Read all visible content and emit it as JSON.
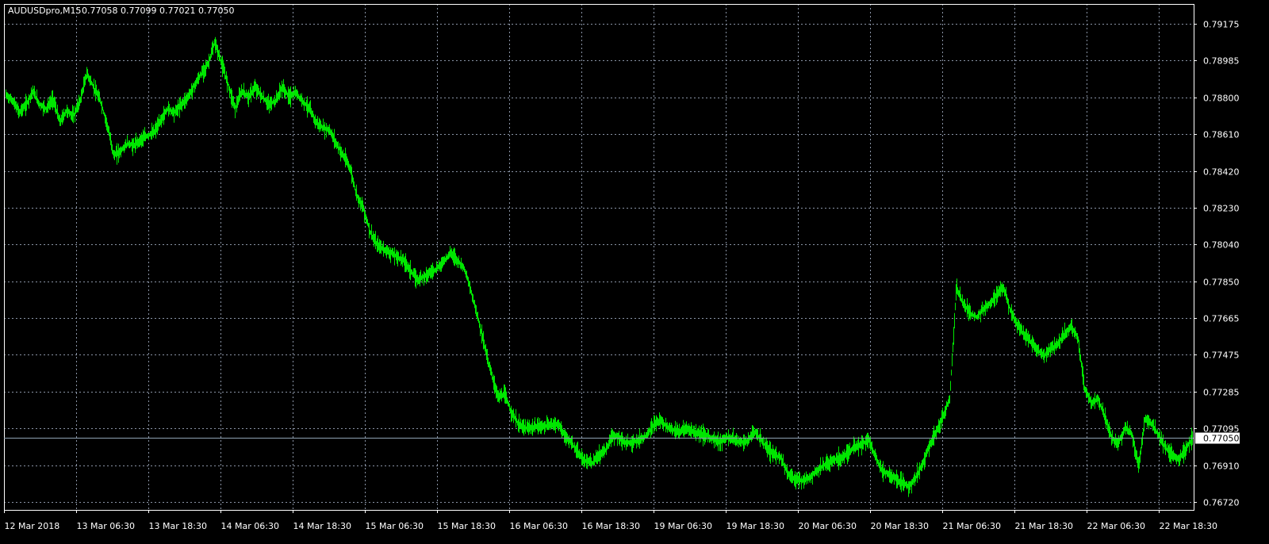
{
  "window": {
    "symbol_timeframe": "AUDUSDpro,M15",
    "ohlc_readout": "0.77058 0.77099 0.77021 0.77050"
  },
  "colors": {
    "background": "#000000",
    "candles": "#00e600",
    "grid": "#8a94a6",
    "axis": "#ffffff",
    "current_price_line": "#8fa2b3",
    "current_price_tag_bg": "#ffffff",
    "current_price_tag_text": "#000000"
  },
  "chart_data": {
    "type": "line",
    "symbol": "AUDUSDpro",
    "timeframe": "M15",
    "current_price": 0.7705,
    "current_price_label": "0.77050",
    "y_axis": {
      "min": 0.7672,
      "max": 0.79175,
      "ticks": [
        "0.79175",
        "0.78985",
        "0.78800",
        "0.78610",
        "0.78420",
        "0.78230",
        "0.78040",
        "0.77850",
        "0.77665",
        "0.77475",
        "0.77285",
        "0.77095",
        "0.76910",
        "0.76720"
      ]
    },
    "x_axis": {
      "ticks": [
        "12 Mar 2018",
        "13 Mar 06:30",
        "13 Mar 18:30",
        "14 Mar 06:30",
        "14 Mar 18:30",
        "15 Mar 06:30",
        "15 Mar 18:30",
        "16 Mar 06:30",
        "16 Mar 18:30",
        "19 Mar 06:30",
        "19 Mar 18:30",
        "20 Mar 06:30",
        "20 Mar 18:30",
        "21 Mar 06:30",
        "21 Mar 18:30",
        "22 Mar 06:30",
        "22 Mar 18:30"
      ]
    },
    "grid": true,
    "series": [
      {
        "values": [
          0.7881,
          0.7878,
          0.7872,
          0.7876,
          0.7883,
          0.7876,
          0.7874,
          0.7879,
          0.7867,
          0.7873,
          0.787,
          0.7878,
          0.7892,
          0.7885,
          0.7878,
          0.7866,
          0.785,
          0.7852,
          0.7856,
          0.7855,
          0.7858,
          0.786,
          0.7862,
          0.7868,
          0.7874,
          0.7872,
          0.7876,
          0.788,
          0.7886,
          0.7892,
          0.7897,
          0.7908,
          0.7897,
          0.7886,
          0.7874,
          0.7883,
          0.788,
          0.7885,
          0.788,
          0.7876,
          0.7878,
          0.7885,
          0.788,
          0.7882,
          0.7878,
          0.7874,
          0.7867,
          0.7864,
          0.7863,
          0.7856,
          0.785,
          0.7844,
          0.783,
          0.7823,
          0.7811,
          0.7804,
          0.7802,
          0.78,
          0.7798,
          0.7796,
          0.7791,
          0.7786,
          0.7788,
          0.779,
          0.7792,
          0.7796,
          0.78,
          0.7796,
          0.7792,
          0.778,
          0.7767,
          0.7752,
          0.7738,
          0.7726,
          0.7727,
          0.7718,
          0.7712,
          0.771,
          0.771,
          0.7711,
          0.7711,
          0.7712,
          0.7712,
          0.7705,
          0.7702,
          0.7696,
          0.7693,
          0.7692,
          0.7696,
          0.7699,
          0.7706,
          0.7705,
          0.7702,
          0.7703,
          0.7704,
          0.7706,
          0.7711,
          0.7714,
          0.7711,
          0.7709,
          0.7708,
          0.771,
          0.7708,
          0.7707,
          0.7706,
          0.7704,
          0.7703,
          0.7705,
          0.7704,
          0.7703,
          0.7703,
          0.7708,
          0.7704,
          0.7699,
          0.7696,
          0.7695,
          0.7686,
          0.7684,
          0.7683,
          0.7684,
          0.7687,
          0.769,
          0.7692,
          0.7694,
          0.7695,
          0.7698,
          0.77,
          0.7702,
          0.7704,
          0.7695,
          0.7688,
          0.7686,
          0.7684,
          0.7682,
          0.768,
          0.7685,
          0.7692,
          0.7701,
          0.7708,
          0.7716,
          0.7725,
          0.7782,
          0.7774,
          0.7769,
          0.7767,
          0.7771,
          0.7774,
          0.7779,
          0.7782,
          0.777,
          0.7763,
          0.7758,
          0.7754,
          0.775,
          0.7747,
          0.7751,
          0.7753,
          0.7758,
          0.7762,
          0.7757,
          0.773,
          0.7723,
          0.7725,
          0.7716,
          0.7705,
          0.7702,
          0.771,
          0.7707,
          0.769,
          0.7715,
          0.7712,
          0.7706,
          0.77,
          0.7696,
          0.7694,
          0.7699,
          0.7705
        ]
      }
    ]
  }
}
